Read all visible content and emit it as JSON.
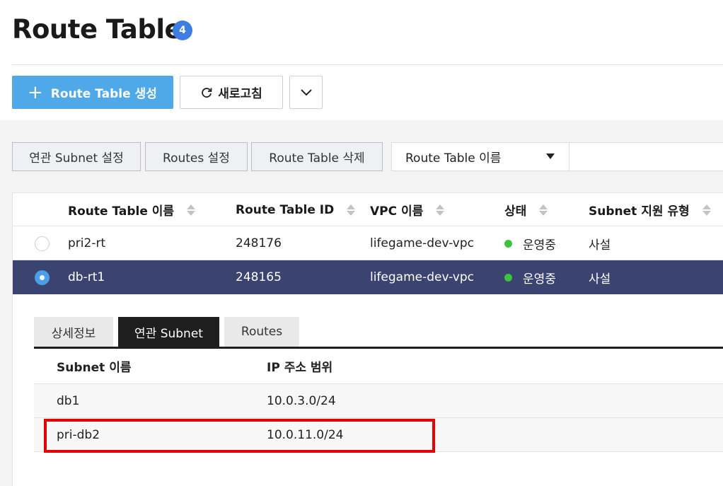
{
  "header": {
    "title": "Route Table",
    "count": "4",
    "create_button_label": "Route Table 생성",
    "refresh_button_label": "새로고침"
  },
  "actions": {
    "associate_subnet_label": "연관 Subnet 설정",
    "routes_setting_label": "Routes 설정",
    "delete_label": "Route Table 삭제"
  },
  "search": {
    "field_selected": "Route Table 이름",
    "query": ""
  },
  "table": {
    "columns": [
      "Route Table 이름",
      "Route Table ID",
      "VPC 이름",
      "상태",
      "Subnet 지원 유형"
    ],
    "rows": [
      {
        "name": "pri2-rt",
        "id": "248176",
        "vpc": "lifegame-dev-vpc",
        "status": "운영중",
        "subnet_type": "사설",
        "selected": false
      },
      {
        "name": "db-rt1",
        "id": "248165",
        "vpc": "lifegame-dev-vpc",
        "status": "운영중",
        "subnet_type": "사설",
        "selected": true
      }
    ]
  },
  "detail": {
    "tabs": [
      "상세정보",
      "연관 Subnet",
      "Routes"
    ],
    "active_tab": "연관 Subnet",
    "columns": [
      "Subnet 이름",
      "IP 주소 범위"
    ],
    "rows": [
      {
        "subnet": "db1",
        "ip_range": "10.0.3.0/24"
      },
      {
        "subnet": "pri-db2",
        "ip_range": "10.0.11.0/24"
      }
    ]
  },
  "colors": {
    "accent": "#4fa8e8",
    "badge": "#3d7ee0",
    "selected_row": "#3b4371",
    "status_running": "#3cc43c",
    "highlight": "#e60000"
  }
}
